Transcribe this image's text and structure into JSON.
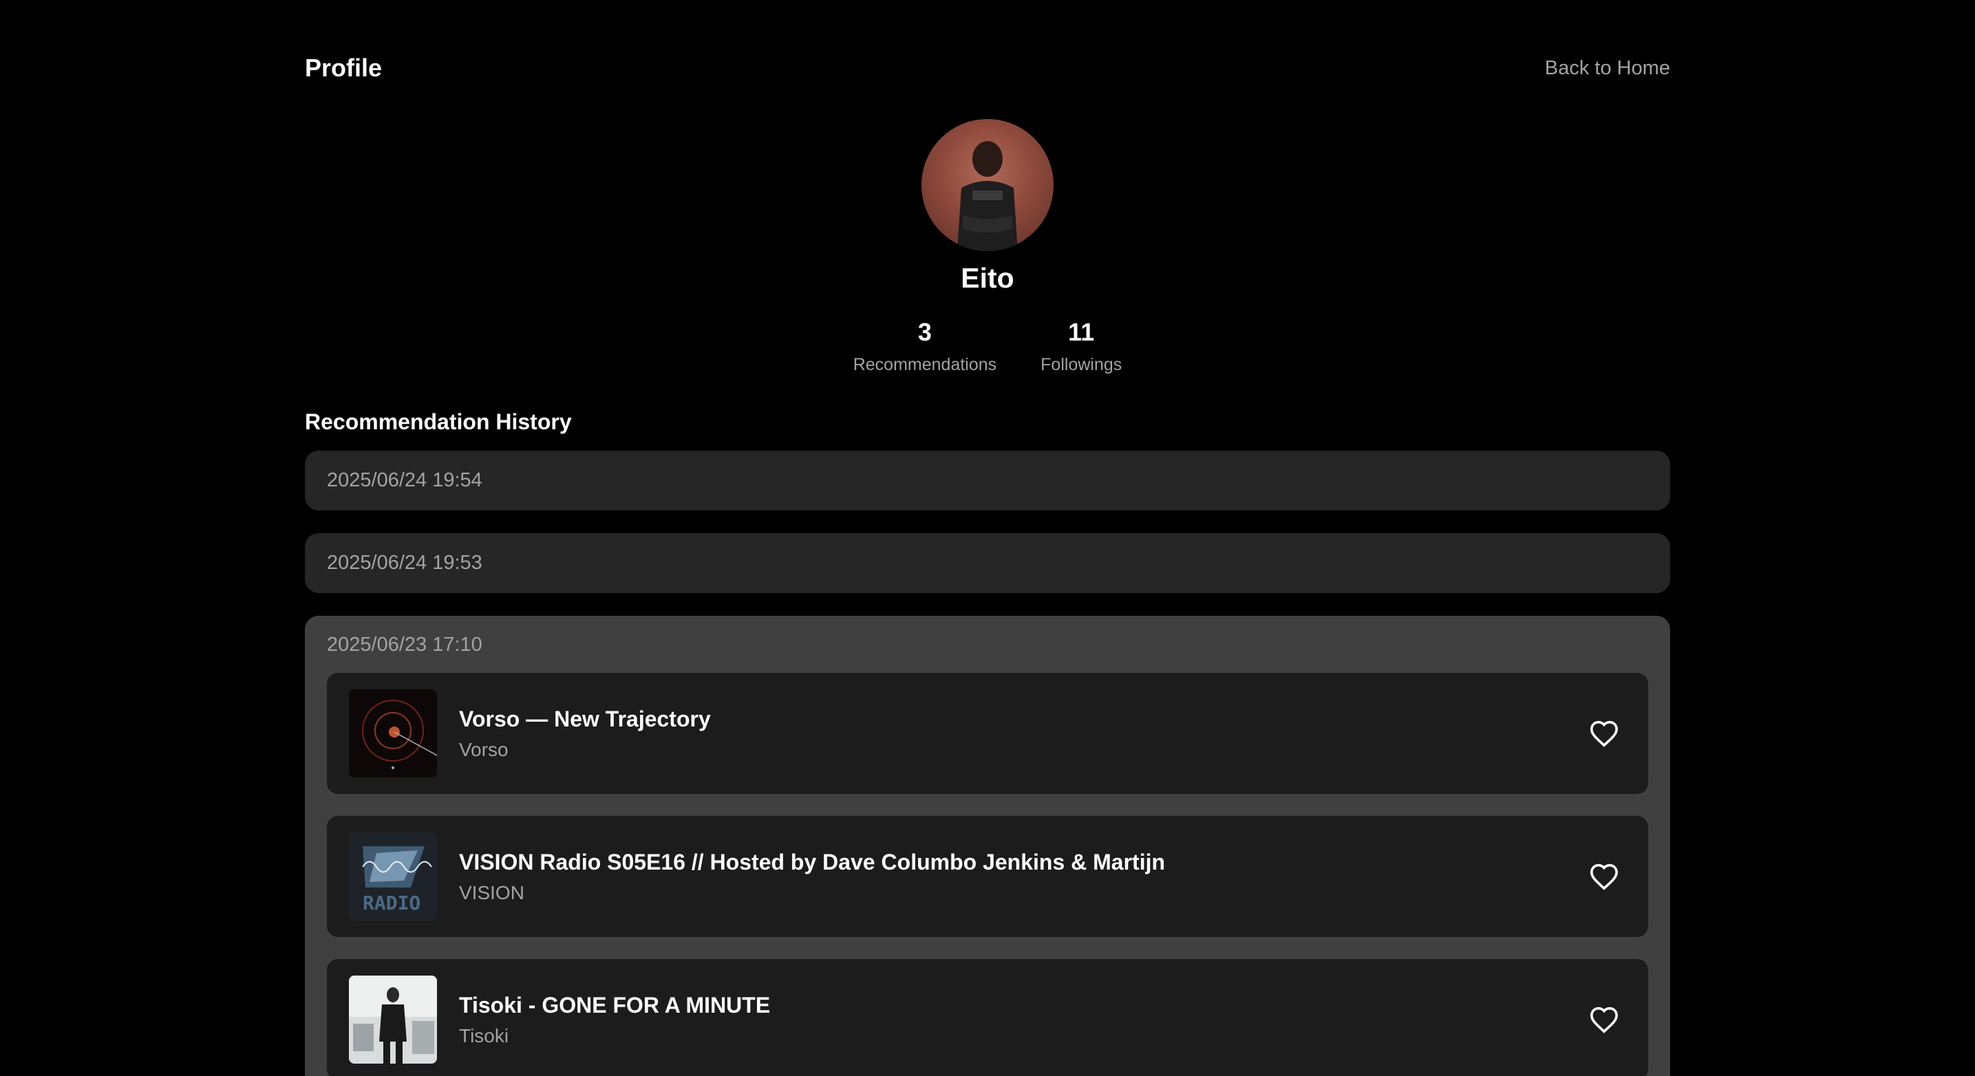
{
  "header": {
    "title": "Profile",
    "back_label": "Back to Home"
  },
  "profile": {
    "name": "Eito",
    "stats": [
      {
        "value": "3",
        "label": "Recommendations"
      },
      {
        "value": "11",
        "label": "Followings"
      }
    ]
  },
  "history": {
    "title": "Recommendation History",
    "entries": [
      {
        "date": "2025/06/24 19:54",
        "expanded": false
      },
      {
        "date": "2025/06/24 19:53",
        "expanded": false
      },
      {
        "date": "2025/06/23 17:10",
        "expanded": true,
        "tracks": [
          {
            "title": "Vorso — New Trajectory",
            "artist": "Vorso",
            "cover_icon": "orbit-cover"
          },
          {
            "title": "VISION Radio S05E16 // Hosted by Dave Columbo Jenkins & Martijn",
            "artist": "VISION",
            "cover_icon": "radio-cover"
          },
          {
            "title": "Tisoki - GONE FOR A MINUTE",
            "artist": "Tisoki",
            "cover_icon": "photo-cover"
          }
        ]
      }
    ]
  },
  "colors": {
    "background": "#000000",
    "collapsed_entry": "#262626",
    "expanded_entry": "#404040",
    "track_card": "#1c1c1c",
    "muted_text": "#a3a3a3"
  }
}
